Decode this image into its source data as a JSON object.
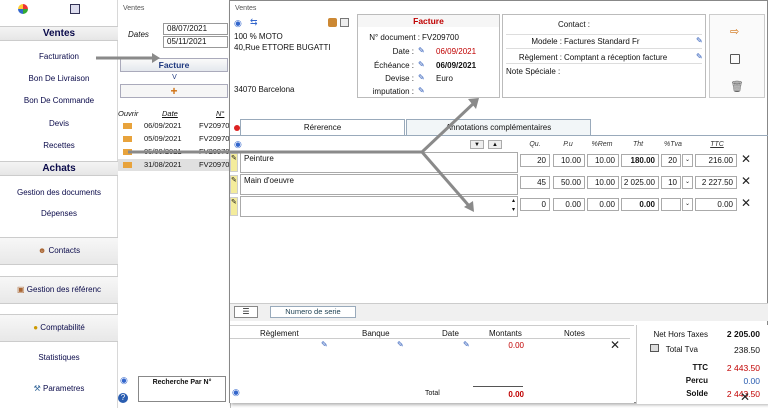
{
  "sidebar": {
    "sections": [
      {
        "head": "Ventes",
        "items": [
          "Facturation",
          "Bon De Livraison",
          "Bon De Commande",
          "Devis",
          "Recettes"
        ]
      },
      {
        "head": "Achats",
        "items": [
          "Gestion des documents",
          "Dépenses"
        ]
      }
    ],
    "contacts": "Contacts",
    "gestion_ref": "Gestion des référenc",
    "comptabilite": "Comptabilité",
    "statistiques": "Statistiques",
    "parametres": "Parametres"
  },
  "list_panel": {
    "title": "Ventes",
    "dates_label": "Dates",
    "date_from": "08/07/2021",
    "date_to": "05/11/2021",
    "facture_btn": "Facture",
    "v_label": "V",
    "col_ouvrir": "Ouvrir",
    "col_date": "Date",
    "col_num": "N°",
    "rows": [
      {
        "date": "06/09/2021",
        "num": "FV20970"
      },
      {
        "date": "05/09/2021",
        "num": "FV20970"
      },
      {
        "date": "05/09/2021",
        "num": "FV20970"
      },
      {
        "date": "31/08/2021",
        "num": "FV20970"
      }
    ],
    "search_label": "Recherche Par N°"
  },
  "invoice": {
    "window_title": "Ventes",
    "client_name": "100 % MOTO",
    "client_address": "40,Rue ETTORE BUGATTI",
    "client_city": "34070 Barcelona",
    "doc_type": "Facture",
    "doc_number_label": "N° document :",
    "doc_number": "FV209700",
    "date_label": "Date :",
    "date": "06/09/2021",
    "echeance_label": "Échéance :",
    "echeance": "06/09/2021",
    "devise_label": "Devise :",
    "devise": "Euro",
    "imputation_label": "imputation :",
    "contact_label": "Contact :",
    "modele_label": "Modele :",
    "modele": "Factures Standard Fr",
    "reglement_label": "Règlement :",
    "reglement": "Comptant a réception facture",
    "note_label": "Note Spéciale :"
  },
  "tabs": {
    "reference": "Rérerence",
    "annotations": "Annotations complémentaires"
  },
  "grid": {
    "headers": {
      "qu": "Qu.",
      "pu": "P.u",
      "rem": "%Rem",
      "tht": "Tht",
      "tva": "%Tva",
      "ttc": "TTC"
    },
    "lines": [
      {
        "desc": "Peinture",
        "qu": "20",
        "pu": "10.00",
        "rem": "10.00",
        "tht": "180.00",
        "tva": "20",
        "ttc": "216.00"
      },
      {
        "desc": "Main d'oeuvre",
        "qu": "45",
        "pu": "50.00",
        "rem": "10.00",
        "tht": "2 025.00",
        "tva": "10",
        "ttc": "2 227.50"
      },
      {
        "desc": "",
        "qu": "0",
        "pu": "0.00",
        "rem": "0.00",
        "tht": "0.00",
        "tva": "",
        "ttc": "0.00"
      }
    ],
    "serial_btn": "Numero de serie"
  },
  "payments": {
    "col_reglement": "Règlement",
    "col_banque": "Banque",
    "col_date": "Date",
    "col_montants": "Montants",
    "col_notes": "Notes",
    "row_amount": "0.00",
    "total_label": "Total",
    "total_value": "0.00"
  },
  "totals": {
    "net_ht_label": "Net Hors Taxes",
    "net_ht": "2 205.00",
    "tva_label": "Total Tva",
    "tva": "238.50",
    "ttc_label": "TTC",
    "ttc": "2 443.50",
    "percu_label": "Percu",
    "percu": "0.00",
    "solde_label": "Solde",
    "solde": "2 443.50"
  },
  "colors": {
    "accent_red": "#c00000",
    "nav_blue": "#0a0a4a",
    "pencil_blue": "#1e4fb4",
    "arrow_gray": "#8a8a8a"
  }
}
